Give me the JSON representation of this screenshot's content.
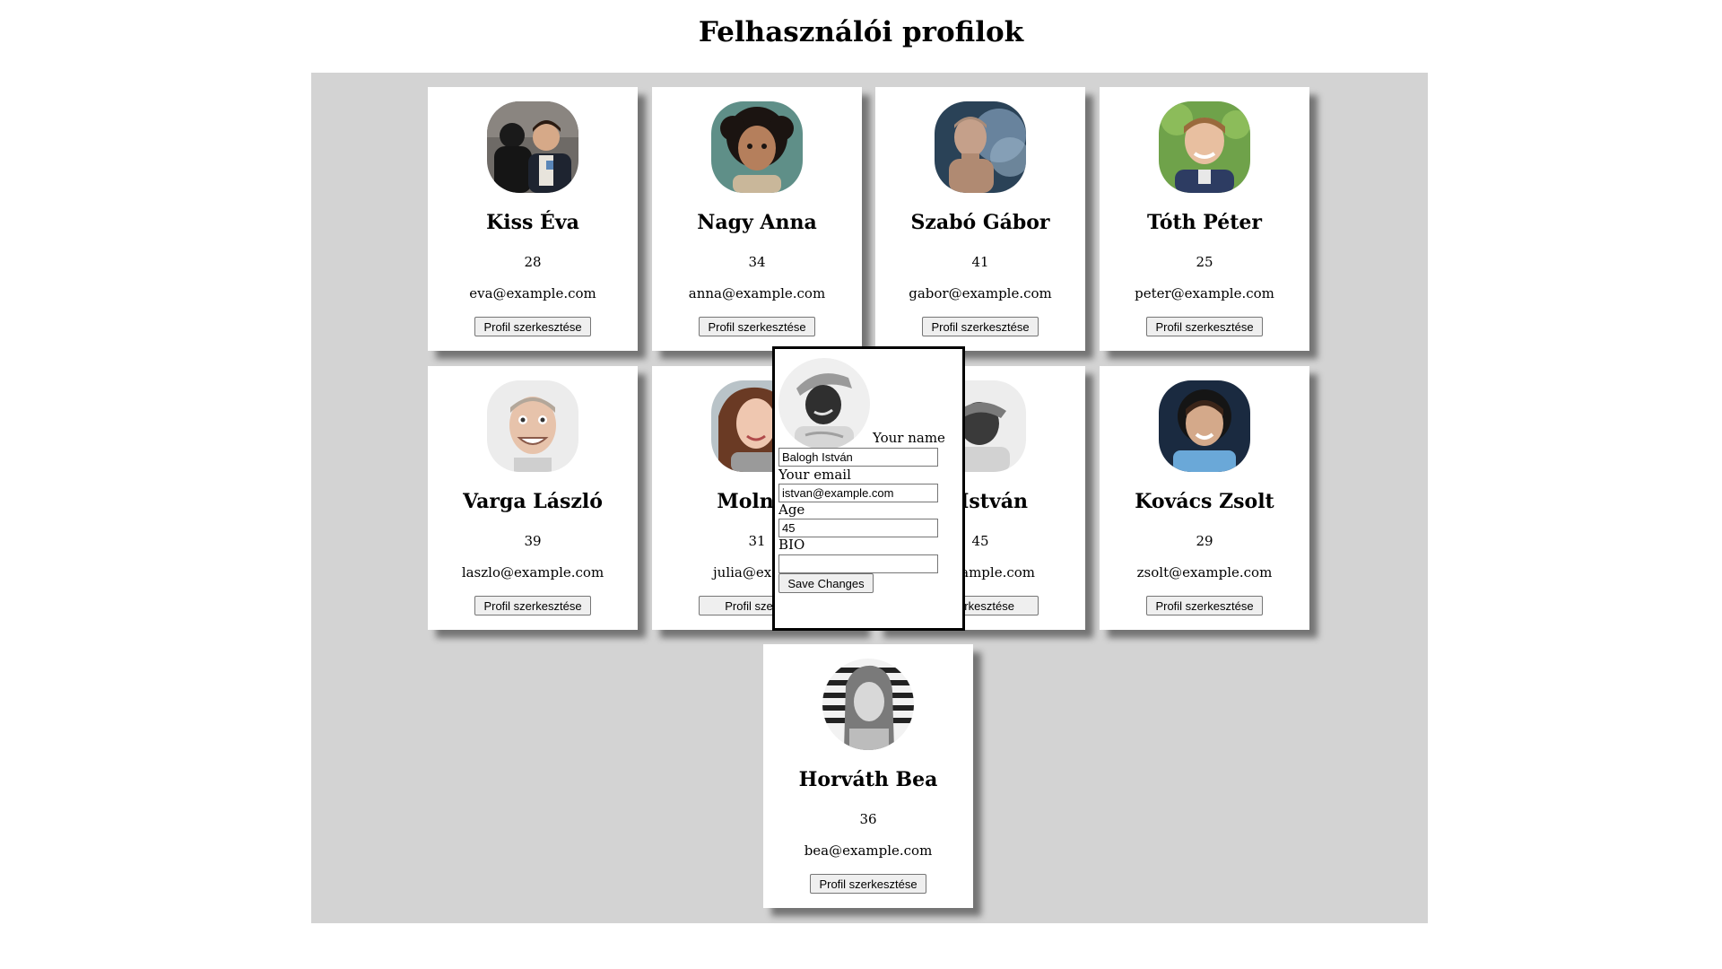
{
  "page": {
    "title": "Felhasználói profilok"
  },
  "profile_cards": [
    {
      "name": "Kiss Éva",
      "age": "28",
      "email": "eva@example.com",
      "edit_label": "Profil szerkesztése"
    },
    {
      "name": "Nagy Anna",
      "age": "34",
      "email": "anna@example.com",
      "edit_label": "Profil szerkesztése"
    },
    {
      "name": "Szabó Gábor",
      "age": "41",
      "email": "gabor@example.com",
      "edit_label": "Profil szerkesztése"
    },
    {
      "name": "Tóth Péter",
      "age": "25",
      "email": "peter@example.com",
      "edit_label": "Profil szerkesztése"
    },
    {
      "name": "Varga László",
      "age": "39",
      "email": "laszlo@example.com",
      "edit_label": "Profil szerkesztése"
    },
    {
      "name": "Molnár",
      "age": "31",
      "email": "julia@examp",
      "edit_label": "Profil szerke"
    },
    {
      "name": "gh István",
      "age": "45",
      "email": "example.com",
      "edit_label": "szerkesztése"
    },
    {
      "name": "Kovács Zsolt",
      "age": "29",
      "email": "zsolt@example.com",
      "edit_label": "Profil szerkesztése"
    },
    {
      "name": "Horváth Bea",
      "age": "36",
      "email": "bea@example.com",
      "edit_label": "Profil szerkesztése"
    }
  ],
  "edit_modal": {
    "name_label": "Your name",
    "name_value": "Balogh István",
    "email_label": "Your email",
    "email_value": "istvan@example.com",
    "age_label": "Age",
    "age_value": "45",
    "bio_label": "BIO",
    "bio_value": "",
    "save_label": "Save Changes"
  }
}
